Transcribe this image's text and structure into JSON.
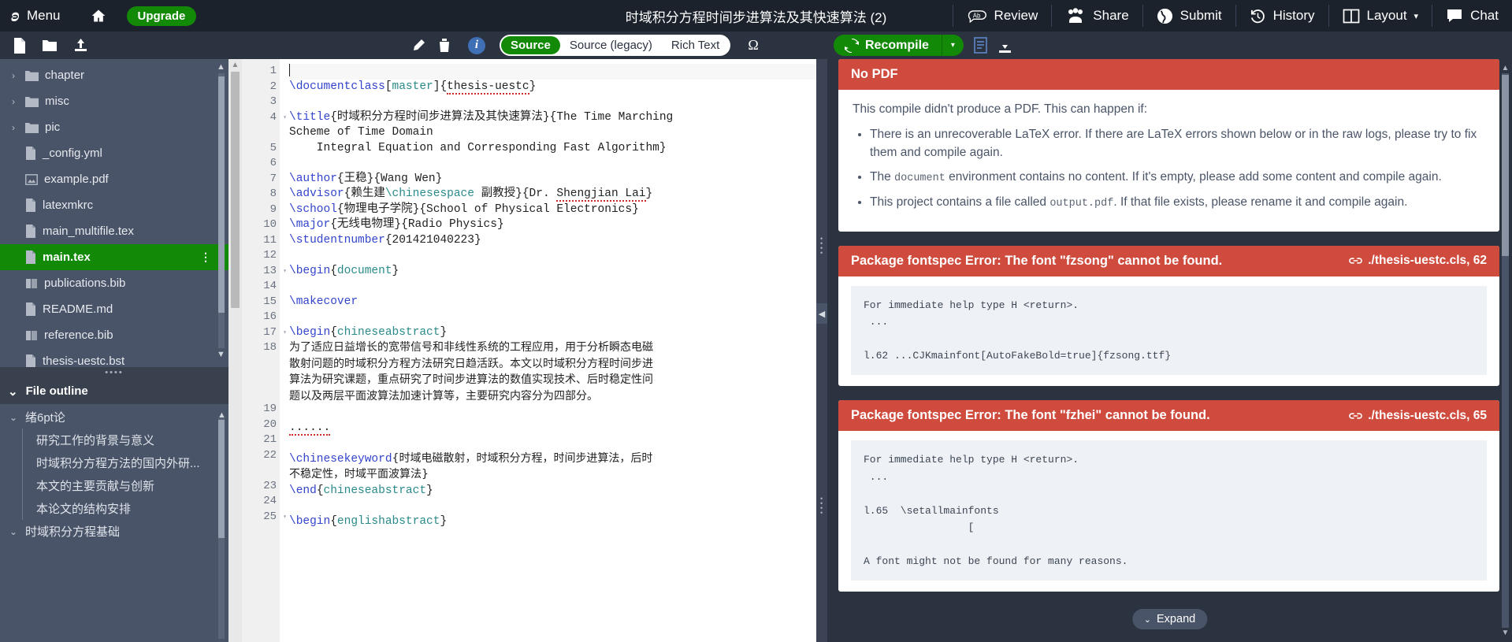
{
  "topnav": {
    "logo": "overleaf-logo-icon",
    "menu_label": "Menu",
    "home_label": "home-icon",
    "upgrade_label": "Upgrade",
    "project_title": "时域积分方程时间步进算法及其快速算法 (2)",
    "right_items": [
      {
        "label": "Review",
        "icon": "review-icon"
      },
      {
        "label": "Share",
        "icon": "users-icon"
      },
      {
        "label": "Submit",
        "icon": "globe-icon"
      },
      {
        "label": "History",
        "icon": "history-icon"
      },
      {
        "label": "Layout",
        "icon": "layout-icon",
        "caret": "▾"
      },
      {
        "label": "Chat",
        "icon": "chat-icon"
      }
    ]
  },
  "filetree": {
    "toolbar": [
      {
        "name": "new-file-icon"
      },
      {
        "name": "new-folder-icon"
      },
      {
        "name": "upload-icon"
      }
    ],
    "items": [
      {
        "label": "chapter",
        "type": "folder",
        "expandable": true,
        "selected": false
      },
      {
        "label": "misc",
        "type": "folder",
        "expandable": true,
        "selected": false
      },
      {
        "label": "pic",
        "type": "folder",
        "expandable": true,
        "selected": false
      },
      {
        "label": "_config.yml",
        "type": "file",
        "expandable": false,
        "selected": false
      },
      {
        "label": "example.pdf",
        "type": "image",
        "expandable": false,
        "selected": false
      },
      {
        "label": "latexmkrc",
        "type": "file",
        "expandable": false,
        "selected": false
      },
      {
        "label": "main_multifile.tex",
        "type": "file",
        "expandable": false,
        "selected": false
      },
      {
        "label": "main.tex",
        "type": "file",
        "expandable": false,
        "selected": true,
        "menu": "⋮"
      },
      {
        "label": "publications.bib",
        "type": "bib",
        "expandable": false,
        "selected": false
      },
      {
        "label": "README.md",
        "type": "file",
        "expandable": false,
        "selected": false
      },
      {
        "label": "reference.bib",
        "type": "bib",
        "expandable": false,
        "selected": false
      },
      {
        "label": "thesis-uestc.bst",
        "type": "file",
        "expandable": false,
        "selected": false
      }
    ]
  },
  "outline": {
    "title": "File outline",
    "caret": "⌄",
    "items": [
      {
        "label": "绪6pt论",
        "level": 0,
        "caret": "⌄"
      },
      {
        "label": "研究工作的背景与意义",
        "level": 1
      },
      {
        "label": "时域积分方程方法的国内外研...",
        "level": 1
      },
      {
        "label": "本文的主要贡献与创新",
        "level": 1
      },
      {
        "label": "本论文的结构安排",
        "level": 1
      },
      {
        "label": "时域积分方程基础",
        "level": 0,
        "caret": "⌄"
      }
    ]
  },
  "editor": {
    "toolbar": {
      "edit_icon": "pencil-icon",
      "delete_icon": "trash-icon",
      "info_icon": "info-icon",
      "omega_icon": "Ω",
      "modes": [
        {
          "label": "Source",
          "active": true
        },
        {
          "label": "Source (legacy)",
          "active": false
        },
        {
          "label": "Rich Text",
          "active": false
        }
      ]
    },
    "lines": [
      {
        "n": "1",
        "fold": false,
        "text": "",
        "cursor": true
      },
      {
        "n": "2",
        "fold": false,
        "segments": [
          {
            "t": "\\documentclass",
            "c": "kw"
          },
          {
            "t": "[",
            "c": ""
          },
          {
            "t": "master",
            "c": "arg"
          },
          {
            "t": "]{",
            "c": ""
          },
          {
            "t": "thesis-uestc",
            "c": "spell"
          },
          {
            "t": "}",
            "c": ""
          }
        ]
      },
      {
        "n": "3",
        "fold": false,
        "segments": []
      },
      {
        "n": "4",
        "fold": true,
        "segments": [
          {
            "t": "\\title",
            "c": "kw"
          },
          {
            "t": "{时域积分方程时间步进算法及其快速算法}{The Time Marching",
            "c": ""
          }
        ]
      },
      {
        "n": "",
        "fold": false,
        "segments": [
          {
            "t": "Scheme of Time Domain",
            "c": ""
          }
        ]
      },
      {
        "n": "5",
        "fold": false,
        "segments": [
          {
            "t": "    Integral Equation and Corresponding Fast Algorithm}",
            "c": ""
          }
        ]
      },
      {
        "n": "6",
        "fold": false,
        "segments": []
      },
      {
        "n": "7",
        "fold": false,
        "segments": [
          {
            "t": "\\author",
            "c": "kw"
          },
          {
            "t": "{王稳}{Wang Wen}",
            "c": ""
          }
        ]
      },
      {
        "n": "8",
        "fold": false,
        "segments": [
          {
            "t": "\\advisor",
            "c": "kw"
          },
          {
            "t": "{赖生建",
            "c": ""
          },
          {
            "t": "\\chinesespace",
            "c": "arg"
          },
          {
            "t": " 副教授}{Dr. ",
            "c": ""
          },
          {
            "t": "Shengjian Lai",
            "c": "spell"
          },
          {
            "t": "}",
            "c": ""
          }
        ]
      },
      {
        "n": "9",
        "fold": false,
        "segments": [
          {
            "t": "\\school",
            "c": "kw"
          },
          {
            "t": "{物理电子学院}{School of Physical Electronics}",
            "c": ""
          }
        ]
      },
      {
        "n": "10",
        "fold": false,
        "segments": [
          {
            "t": "\\major",
            "c": "kw"
          },
          {
            "t": "{无线电物理}{Radio Physics}",
            "c": ""
          }
        ]
      },
      {
        "n": "11",
        "fold": false,
        "segments": [
          {
            "t": "\\studentnumber",
            "c": "kw"
          },
          {
            "t": "{201421040223}",
            "c": ""
          }
        ]
      },
      {
        "n": "12",
        "fold": false,
        "segments": []
      },
      {
        "n": "13",
        "fold": true,
        "segments": [
          {
            "t": "\\begin",
            "c": "kw"
          },
          {
            "t": "{",
            "c": ""
          },
          {
            "t": "document",
            "c": "arg"
          },
          {
            "t": "}",
            "c": ""
          }
        ]
      },
      {
        "n": "14",
        "fold": false,
        "segments": []
      },
      {
        "n": "15",
        "fold": false,
        "segments": [
          {
            "t": "\\makecover",
            "c": "kw"
          }
        ]
      },
      {
        "n": "16",
        "fold": false,
        "segments": []
      },
      {
        "n": "17",
        "fold": true,
        "segments": [
          {
            "t": "\\begin",
            "c": "kw"
          },
          {
            "t": "{",
            "c": ""
          },
          {
            "t": "chineseabstract",
            "c": "arg"
          },
          {
            "t": "}",
            "c": ""
          }
        ]
      },
      {
        "n": "18",
        "fold": false,
        "wrap": true,
        "text_cn": "为了适应日益增长的宽带信号和非线性系统的工程应用，用于分析瞬态电磁散射问题的时域积分方程方法研究日趋活跃。本文以时域积分方程时间步进算法为研究课题，重点研究了时间步进算法的数值实现技术、后时稳定性问题以及两层平面波算法加速计算等，主要研究内容分为四部分。"
      },
      {
        "n": "19",
        "fold": false,
        "segments": []
      },
      {
        "n": "20",
        "fold": false,
        "segments": [
          {
            "t": "......",
            "c": "spell"
          }
        ]
      },
      {
        "n": "21",
        "fold": false,
        "segments": []
      },
      {
        "n": "22",
        "fold": false,
        "wrap": true,
        "prefix_kw": "\\chinesekeyword",
        "text_cn": "{时域电磁散射，时域积分方程，时间步进算法，后时不稳定性，时域平面波算法}"
      },
      {
        "n": "23",
        "fold": false,
        "segments": [
          {
            "t": "\\end",
            "c": "kw"
          },
          {
            "t": "{",
            "c": ""
          },
          {
            "t": "chineseabstract",
            "c": "arg"
          },
          {
            "t": "}",
            "c": ""
          }
        ]
      },
      {
        "n": "24",
        "fold": false,
        "segments": []
      },
      {
        "n": "25",
        "fold": true,
        "segments": [
          {
            "t": "\\begin",
            "c": "kw"
          },
          {
            "t": "{",
            "c": ""
          },
          {
            "t": "englishabstract",
            "c": "arg"
          },
          {
            "t": "}",
            "c": ""
          }
        ]
      }
    ]
  },
  "pdf": {
    "toolbar": {
      "recompile_label": "Recompile",
      "dropdown_caret": "▾",
      "log_icon": "document-log-icon",
      "download_icon": "download-icon"
    },
    "nopdf": {
      "title": "No PDF",
      "intro": "This compile didn't produce a PDF. This can happen if:",
      "bullets": [
        {
          "pre": "There is an unrecoverable LaTeX error. If there are LaTeX errors shown below or in the raw logs, please try to fix them and compile again.",
          "code": "",
          "post": ""
        },
        {
          "pre": "The ",
          "code": "document",
          "post": " environment contains no content. If it's empty, please add some content and compile again."
        },
        {
          "pre": "This project contains a file called ",
          "code": "output.pdf",
          "post": ". If that file exists, please rename it and compile again."
        }
      ]
    },
    "errors": [
      {
        "title": "Package fontspec Error: The font \"fzsong\" cannot be found.",
        "location": "./thesis-uestc.cls, 62",
        "link_icon": "link-icon",
        "raw": "For immediate help type H <return>.\n ...\n\nl.62 ...CJKmainfont[AutoFakeBold=true]{fzsong.ttf}"
      },
      {
        "title": "Package fontspec Error: The font \"fzhei\" cannot be found.",
        "location": "./thesis-uestc.cls, 65",
        "link_icon": "link-icon",
        "raw": "For immediate help type H <return>.\n ...\n\nl.65  \\setallmainfonts\n                 [\n\nA font might not be found for many reasons."
      }
    ],
    "expand_label": "Expand",
    "expand_caret": "⌄"
  },
  "colors": {
    "accent_green": "#138a07",
    "error_red": "#cf4b3d",
    "nav_dark": "#1b222c",
    "panel_dark": "#2b3340",
    "sidebar": "#4a5468"
  }
}
